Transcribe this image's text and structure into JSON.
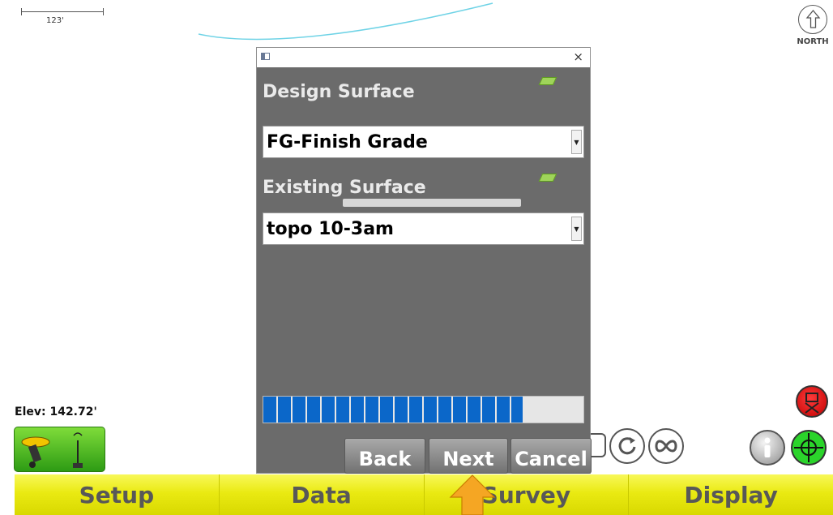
{
  "map": {
    "scale_label": "123'",
    "north_label": "NORTH",
    "elevation": "Elev: 142.72'"
  },
  "dialog": {
    "close_glyph": "×",
    "design_surface_label": "Design Surface",
    "design_surface_value": "FG-Finish Grade",
    "existing_surface_label": "Existing Surface",
    "existing_surface_value": "topo 10-3am",
    "progress_fraction": 0.81,
    "buttons": {
      "back": "Back",
      "next": "Next",
      "cancel": "Cancel"
    }
  },
  "bottom_tabs": [
    "Setup",
    "Data",
    "Survey",
    "Display"
  ],
  "colors": {
    "tab_yellow": "#eaea12",
    "dialog_gray": "#6b6b6b",
    "progress_blue": "#0b67c9",
    "status_green": "#2d9b14",
    "pointer_orange": "#f5a623"
  },
  "icons": [
    "north-arrow-icon",
    "gps-receiver-icon",
    "antenna-icon",
    "surface-icon",
    "rotate-icon",
    "infinity-icon",
    "info-icon",
    "target-crosshair-icon",
    "alert-icon"
  ]
}
